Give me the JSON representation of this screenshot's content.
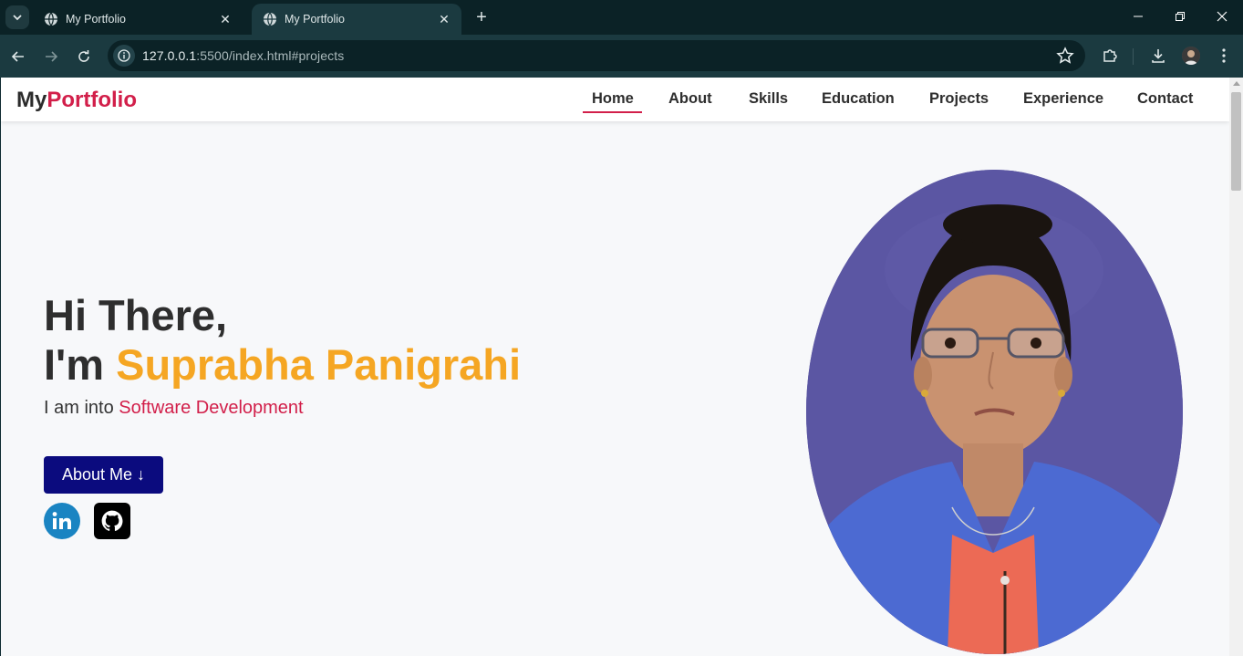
{
  "browser": {
    "tabs": [
      {
        "title": "My Portfolio",
        "active": false
      },
      {
        "title": "My Portfolio",
        "active": true
      }
    ],
    "url_host": "127.0.0.1",
    "url_rest": ":5500/index.html#projects"
  },
  "site": {
    "logo_prefix": "My",
    "logo_accent": "Portfolio",
    "nav": [
      "Home",
      "About",
      "Skills",
      "Education",
      "Projects",
      "Experience",
      "Contact"
    ],
    "active_nav": "Home"
  },
  "hero": {
    "greeting": "Hi There,",
    "im": "I'm ",
    "name": "Suprabha Panigrahi",
    "into_prefix": "I am into ",
    "role": "Software Development",
    "button_label": "About Me ↓"
  },
  "colors": {
    "accent": "#d21f4a",
    "name": "#f5a623",
    "button": "#0b0b7e",
    "linkedin": "#1a84c2"
  },
  "icons": [
    "linkedin-icon",
    "github-icon"
  ]
}
